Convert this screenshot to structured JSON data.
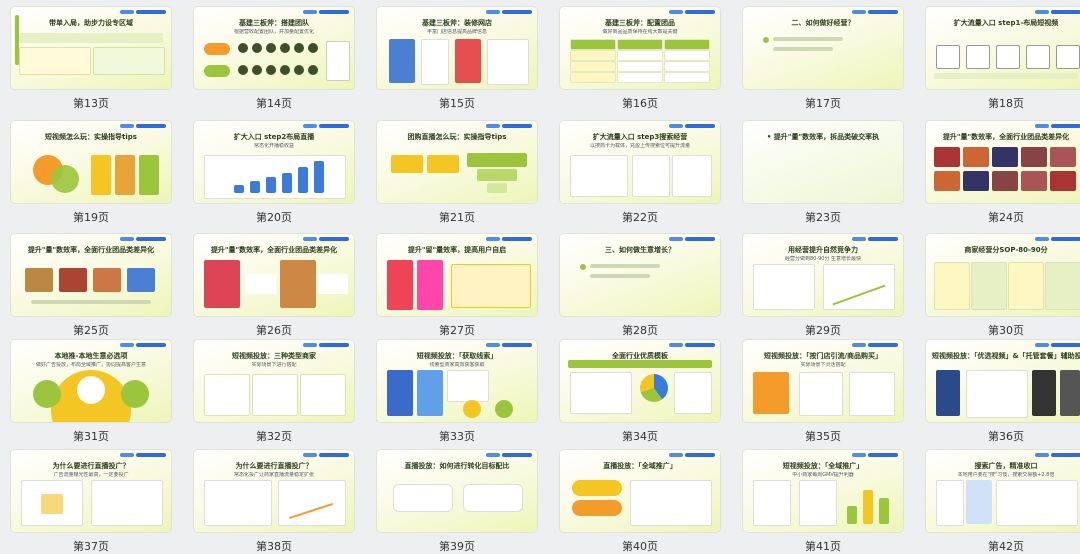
{
  "pages": [
    {
      "label": "第13页",
      "title": "带单入局，助步力设专区域",
      "sub": "",
      "style": "text"
    },
    {
      "label": "第14页",
      "title": "基建三板斧：搭建团队",
      "sub": "根据营收配置团队，并加量配置优化",
      "style": "team"
    },
    {
      "label": "第15页",
      "title": "基建三板斧：装修网店",
      "sub": "丰富门店信息提高品牌信息",
      "style": "phones"
    },
    {
      "label": "第16页",
      "title": "基建三板斧：配置团品",
      "sub": "做好商品品质保持在线大数是关键",
      "style": "table"
    },
    {
      "label": "第17页",
      "title": "二、如何做好经营？",
      "sub": "",
      "style": "section"
    },
    {
      "label": "第18页",
      "title": "扩大流量入口 step1-布局短视频",
      "sub": "",
      "style": "flow"
    },
    {
      "label": "第19页",
      "title": "短视频怎么玩：实操指导tips",
      "sub": "",
      "style": "circles"
    },
    {
      "label": "第20页",
      "title": "扩大入口 step2布局直播",
      "sub": "常态化开播稳收益",
      "style": "bars"
    },
    {
      "label": "第21页",
      "title": "团购直播怎么玩：实操指导tips",
      "sub": "",
      "style": "funnel"
    },
    {
      "label": "第22页",
      "title": "扩大流量入口 step3搜索经营",
      "sub": "以搜商卡为载体，充盈上传搜索位可提升流量",
      "style": "screens"
    },
    {
      "label": "第23页",
      "title": "• 提升\"量\"数效率，拆品类破交率执",
      "sub": "",
      "style": "section2"
    },
    {
      "label": "第24页",
      "title": "提升\"量\"数效率，全面行业团品类差异化",
      "sub": "",
      "style": "gallery"
    },
    {
      "label": "第25页",
      "title": "提升\"量\"数效率，全面行业团品类差异化",
      "sub": "",
      "style": "photos"
    },
    {
      "label": "第26页",
      "title": "提升\"量\"数效率，全面行业团品类差异化",
      "sub": "",
      "style": "cards"
    },
    {
      "label": "第27页",
      "title": "提升\"留\"量效率，提高用户自启",
      "sub": "",
      "style": "list"
    },
    {
      "label": "第28页",
      "title": "三、如何做生意增长？",
      "sub": "",
      "style": "section"
    },
    {
      "label": "第29页",
      "title": "用经营提升自然竞争力",
      "sub": "经营分做到80-90分 生意增长最快",
      "style": "chart"
    },
    {
      "label": "第30页",
      "title": "商家经营分SOP-80-90分",
      "sub": "",
      "style": "columns"
    },
    {
      "label": "第31页",
      "title": "本地推-本地生意必选项",
      "sub": "做好广告投放，布局全域推广，协同提高客户生意",
      "style": "radial"
    },
    {
      "label": "第32页",
      "title": "短视频投放：三种类型商家",
      "sub": "实际场景下进行搭配",
      "style": "three"
    },
    {
      "label": "第33页",
      "title": "短视频投放：「获取线索」",
      "sub": "线索型商家高效获客获取",
      "style": "stats"
    },
    {
      "label": "第34页",
      "title": "全面行业优质模板",
      "sub": "",
      "style": "pie"
    },
    {
      "label": "第35页",
      "title": "短视频投放：「按门店引流/商品购买」",
      "sub": "实际场景下灵活搭配",
      "style": "threephone"
    },
    {
      "label": "第36页",
      "title": "短视频投放：「优选视频」&「托管套餐」辅助投放",
      "sub": "",
      "style": "phones2"
    },
    {
      "label": "第37页",
      "title": "为什么要进行直播投广？",
      "sub": "广告流量曝光性最高，一定要投广",
      "style": "line"
    },
    {
      "label": "第38页",
      "title": "为什么要进行直播投广？",
      "sub": "常态化投广让商家直播流量稳定扩张",
      "style": "line2"
    },
    {
      "label": "第39页",
      "title": "直播投放：如何进行转化目标配比",
      "sub": "",
      "style": "kpi"
    },
    {
      "label": "第40页",
      "title": "直播投放：「全域推广」",
      "sub": "",
      "style": "pill"
    },
    {
      "label": "第41页",
      "title": "短视频投放：「全域推广」",
      "sub": "中小商家每周GMV提升利器",
      "style": "barcomp"
    },
    {
      "label": "第42页",
      "title": "搜索广告，精准收口",
      "sub": "本地用户要在\"搜\"习惯，搜索交易额+2.8倍",
      "style": "search"
    }
  ]
}
